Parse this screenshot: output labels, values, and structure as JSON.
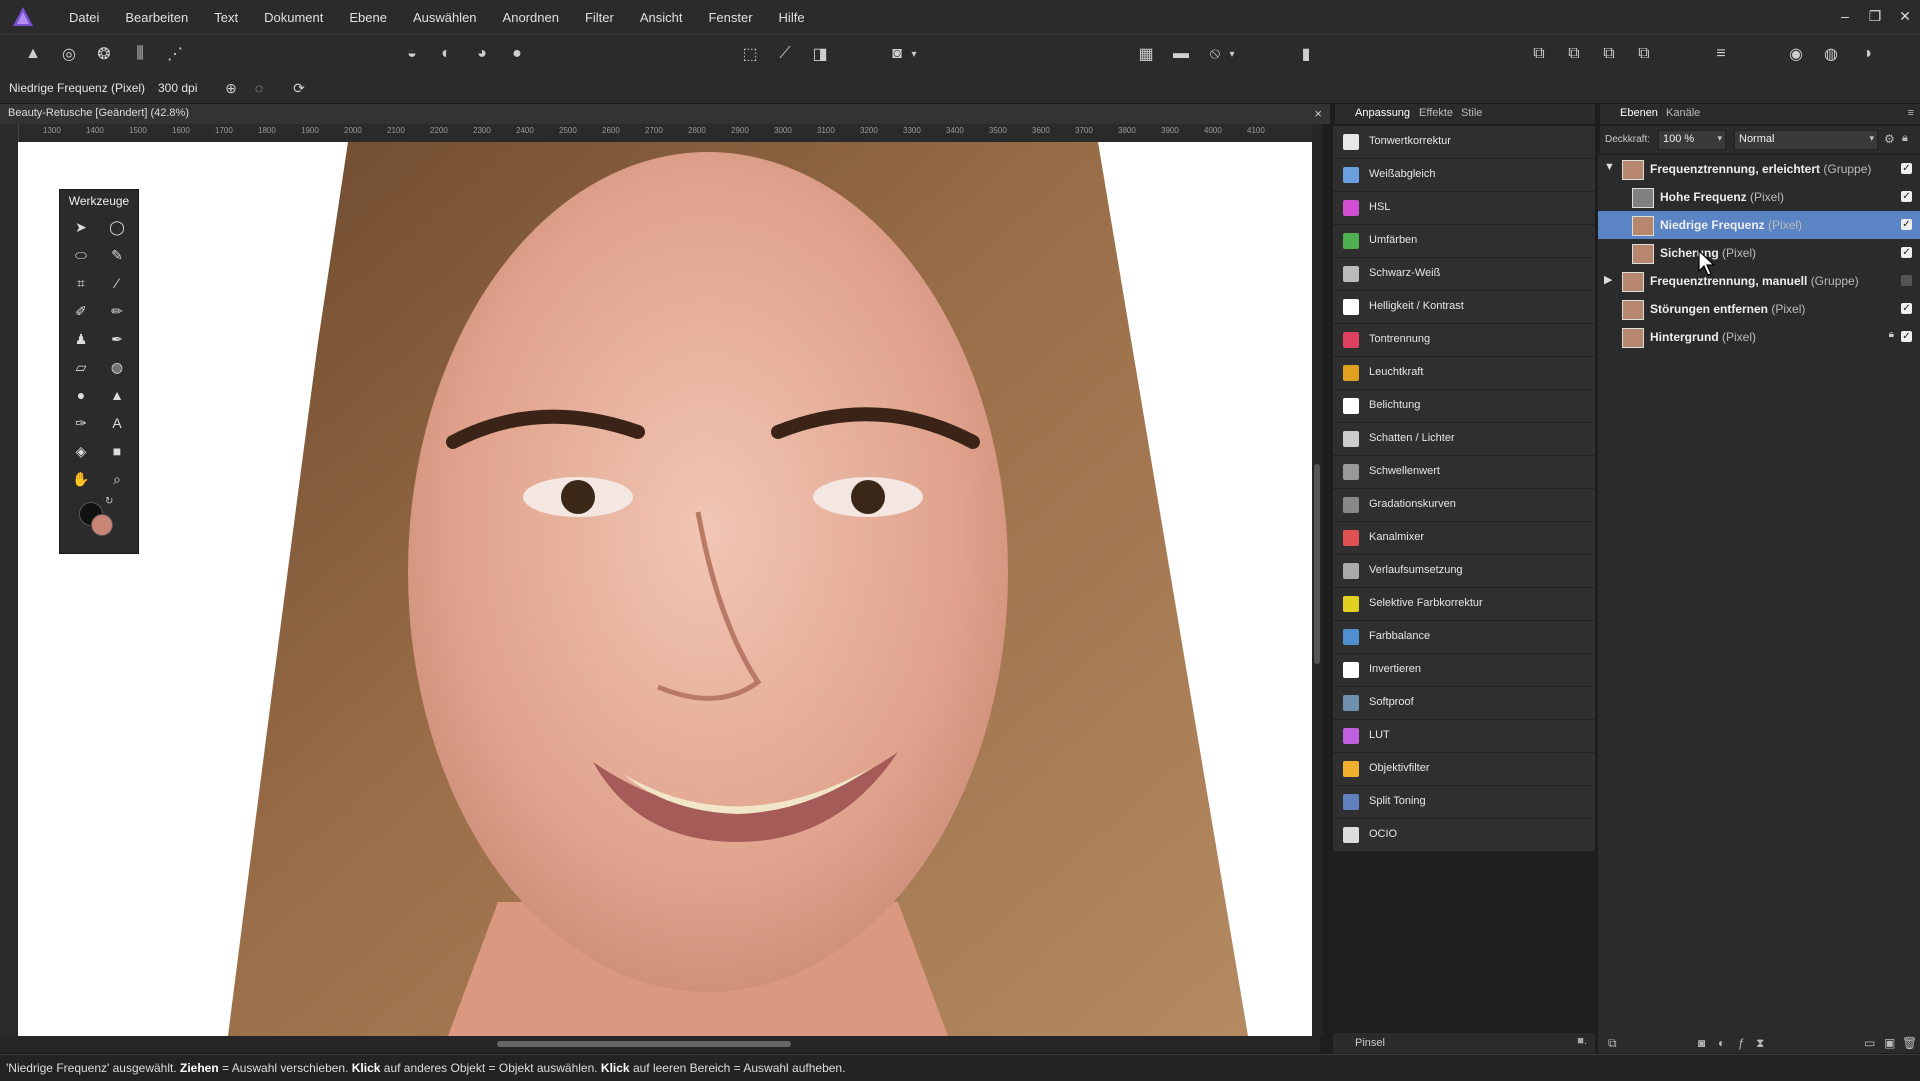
{
  "menubar": {
    "items": [
      "Datei",
      "Bearbeiten",
      "Text",
      "Dokument",
      "Ebene",
      "Auswählen",
      "Anordnen",
      "Filter",
      "Ansicht",
      "Fenster",
      "Hilfe"
    ],
    "window_controls": [
      "–",
      "❐",
      "✕"
    ]
  },
  "context": {
    "layer_label": "Niedrige Frequenz (Pixel)",
    "dpi_label": "300 dpi"
  },
  "document": {
    "tab_title": "Beauty-Retusche [Geändert] (42.8%)",
    "close_label": "×"
  },
  "ruler": {
    "ticks": [
      "1300",
      "1400",
      "1500",
      "1600",
      "1700",
      "1800",
      "1900",
      "2000",
      "2100",
      "2200",
      "2300",
      "2400",
      "2500",
      "2600",
      "2700",
      "2800",
      "2900",
      "3000",
      "3100",
      "3200",
      "3300",
      "3400",
      "3500",
      "3600",
      "3700",
      "3800",
      "3900",
      "4000",
      "4100"
    ]
  },
  "tools": {
    "title": "Werkzeuge"
  },
  "adjustment": {
    "tabs": [
      "Anpassung",
      "Effekte",
      "Stile"
    ],
    "items": [
      {
        "label": "Tonwertkorrektur",
        "color": "#e8e8e8"
      },
      {
        "label": "Weißabgleich",
        "color": "#6aa0e0"
      },
      {
        "label": "HSL",
        "color": "#d04fd0"
      },
      {
        "label": "Umfärben",
        "color": "#4fb04f"
      },
      {
        "label": "Schwarz-Weiß",
        "color": "#bbbbbb"
      },
      {
        "label": "Helligkeit / Kontrast",
        "color": "#ffffff"
      },
      {
        "label": "Tontrennung",
        "color": "#e04060"
      },
      {
        "label": "Leuchtkraft",
        "color": "#e0a020"
      },
      {
        "label": "Belichtung",
        "color": "#ffffff"
      },
      {
        "label": "Schatten / Lichter",
        "color": "#cccccc"
      },
      {
        "label": "Schwellenwert",
        "color": "#999999"
      },
      {
        "label": "Gradationskurven",
        "color": "#888888"
      },
      {
        "label": "Kanalmixer",
        "color": "#e05050"
      },
      {
        "label": "Verlaufsumsetzung",
        "color": "#aaaaaa"
      },
      {
        "label": "Selektive Farbkorrektur",
        "color": "#e0d020"
      },
      {
        "label": "Farbbalance",
        "color": "#5090d0"
      },
      {
        "label": "Invertieren",
        "color": "#ffffff"
      },
      {
        "label": "Softproof",
        "color": "#7090b0"
      },
      {
        "label": "LUT",
        "color": "#c060e0"
      },
      {
        "label": "Objektivfilter",
        "color": "#f0b030"
      },
      {
        "label": "Split Toning",
        "color": "#6080c0"
      },
      {
        "label": "OCIO",
        "color": "#dddddd"
      }
    ],
    "brush_label": "Pinsel"
  },
  "layers": {
    "tabs": [
      "Ebenen",
      "Kanäle"
    ],
    "opacity_label": "Deckkraft:",
    "opacity_value": "100 %",
    "blend_mode": "Normal",
    "items": [
      {
        "name": "Frequenztrennung, erleichtert",
        "type": "(Gruppe)",
        "indent": 0,
        "expanded": true,
        "checked": true
      },
      {
        "name": "Hohe Frequenz",
        "type": "(Pixel)",
        "indent": 1,
        "checked": true
      },
      {
        "name": "Niedrige Frequenz",
        "type": "(Pixel)",
        "indent": 1,
        "checked": true,
        "selected": true
      },
      {
        "name": "Sicherung",
        "type": "(Pixel)",
        "indent": 1,
        "checked": true
      },
      {
        "name": "Frequenztrennung, manuell",
        "type": "(Gruppe)",
        "indent": 0,
        "expanded": false,
        "checked": false
      },
      {
        "name": "Störungen entfernen",
        "type": "(Pixel)",
        "indent": 0,
        "checked": true
      },
      {
        "name": "Hintergrund",
        "type": "(Pixel)",
        "indent": 0,
        "checked": true,
        "locked": true
      }
    ]
  },
  "status": {
    "part1": "'Niedrige Frequenz' ausgewählt. ",
    "k1": "Ziehen",
    "part2": " = Auswahl verschieben. ",
    "k2": "Klick",
    "part3": " auf anderes Objekt = Objekt auswählen. ",
    "k3": "Klick",
    "part4": " auf leeren Bereich = Auswahl aufheben."
  },
  "colors": {
    "accent": "#5b84c4",
    "primary_color": "#111111",
    "secondary_color": "#c98575"
  }
}
